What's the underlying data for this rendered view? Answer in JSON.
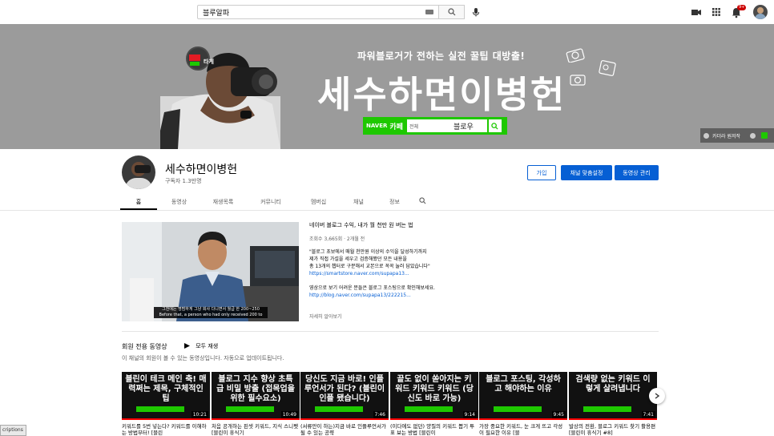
{
  "topbar": {
    "search_value": "블루알파",
    "icons": [
      "keyboard-icon",
      "search-icon",
      "mic-icon",
      "create-video-icon",
      "apps-grid-icon",
      "notifications-icon",
      "account-avatar"
    ],
    "notification_count": "9+"
  },
  "banner": {
    "subtitle_pre": "파워블로거가 전하는 ",
    "subtitle_bold": "실전 꿀팁",
    "subtitle_post": " 대방출!",
    "title": "세수하면이병헌",
    "logo_text": "타게",
    "naver_label": "NAVER",
    "naver_cafe": "카페",
    "naver_select": "전체",
    "naver_query": "블로우",
    "links_text": "카더라 원저작"
  },
  "channel": {
    "name": "세수하면이병헌",
    "subscribers": "구독자 1.3만명",
    "join_label": "가입",
    "customize_label": "채널 맞춤설정",
    "manage_label": "동영상 관리"
  },
  "tabs": [
    "홈",
    "동영상",
    "재생목록",
    "커뮤니티",
    "멤버십",
    "채널",
    "정보"
  ],
  "featured": {
    "title": "네이버 블로그 수익, 내가 월 천만 원 버는 법",
    "meta": "조회수 3,665회 · 2개월 전",
    "desc1": "\"블로그 초보에서 매월 천만원 이상의 수익을 달성하기까지",
    "desc2": "제가 직접 가설을 세우고 검증해봤던 모든 내용을",
    "desc3": "총 13개의 챕터로 구분해서 교본으로 꼭꼭 눌러 담았습니다\"",
    "link1": "https://smartstore.naver.com/supapa13...",
    "desc4": "영상으로 보기 어려운 분들은 블로그 포스팅으로 확인해보세요.",
    "link2": "http://blog.naver.com/supapa13/222215...",
    "more": "자세히 알아보기",
    "caption1": "그전에는 명범하게 그냥 회사 다니면서 월급 한 200~250",
    "caption2": "Before that, a person who had only received 200 to"
  },
  "shelf": {
    "title": "회원 전용 동영상",
    "play_all": "모두 재생",
    "subtitle": "이 채널의 회원이 볼 수 있는 동영상입니다. 자동으로 업데이트됩니다."
  },
  "videos": [
    {
      "thumb": "블린이 테크 메인 축! 매력쩌는 제목, 구체적인 팁",
      "duration": "10:21",
      "title": "키워드를 5번 넣는다? 키워드를 이해하는 방법부터! [블린"
    },
    {
      "thumb": "블로그 지수 향상 초특급 비밀 방출 (접목업을 위한 필수요소)",
      "duration": "10:49",
      "title": "처음 공개하는 핀셋 키워드, 지식 스니펫 [블린이 휴식기"
    },
    {
      "thumb": "당신도 지금 바로! 인플루언서가 된다? (블린이 인플 됐습니다)",
      "duration": "7:46",
      "title": "(서류만이 하는)지금 바로 인플루언서가 될 수 있는 공략"
    },
    {
      "thumb": "끝도 없이 쏟아지는 키워드 키워드 키워드 (당신도 바로 가능)",
      "duration": "9:14",
      "title": "(이다에도 없던) 양질의 키워드 뽑기 투표 보는 방법 [블린이"
    },
    {
      "thumb": "블로그 포스팅, 각성하고 해야하는 이유",
      "duration": "9:45",
      "title": "가장 중요한 키워드, 눈 크게 뜨고 각성이 필요한 이유 [블"
    },
    {
      "thumb": "검색량 없는 키워드 이렇게 살려냅니다",
      "duration": "7:41",
      "title": "발상의 전환, 블로그 키워드 찾기 활용편 [블린이 휴식기 #8]"
    }
  ],
  "tooltip": "criptions",
  "colors": {
    "accent_blue": "#065fd4",
    "naver_green": "#1ec800",
    "progress_red": "#ff0000",
    "banner_gray": "#9b9b9b"
  }
}
